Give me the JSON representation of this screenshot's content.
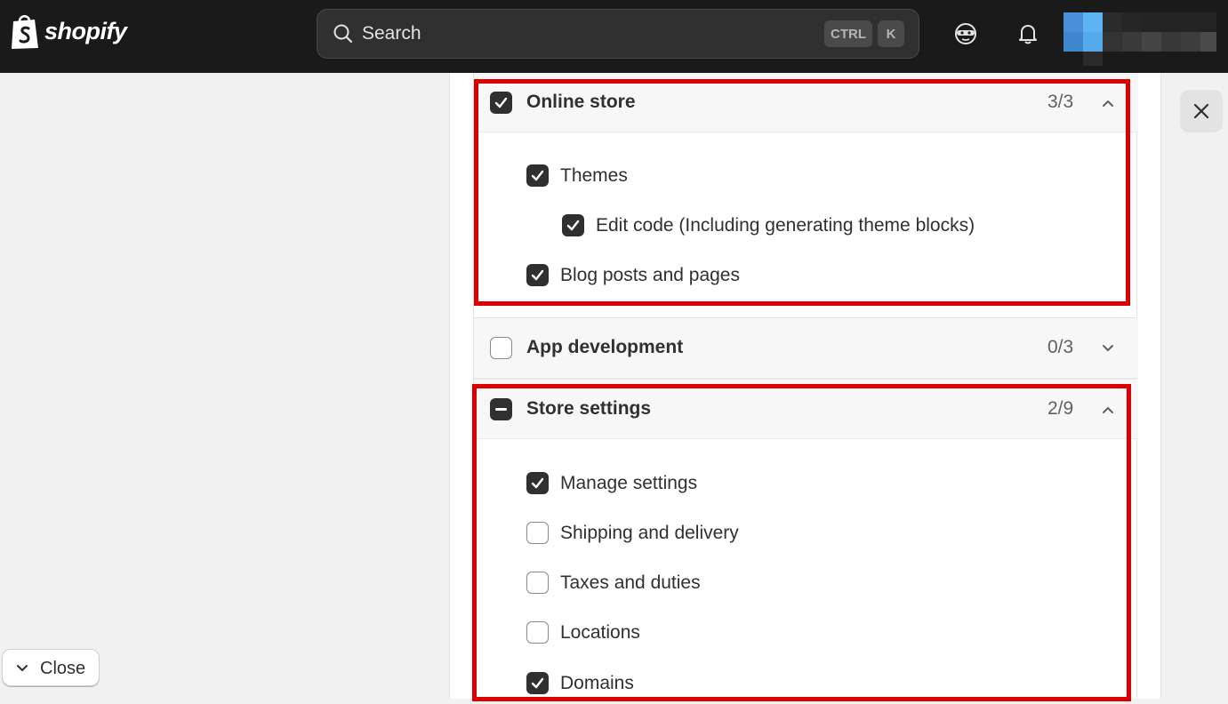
{
  "topbar": {
    "brand": "shopify",
    "search_placeholder": "Search",
    "shortcut_ctrl": "CTRL",
    "shortcut_k": "K"
  },
  "left_panel": {
    "close_label": "Close"
  },
  "sections": {
    "online_store": {
      "title": "Online store",
      "count": "3/3",
      "state": "checked",
      "expanded": true,
      "items": [
        {
          "label": "Themes",
          "checked": true
        },
        {
          "label": "Edit code (Including generating theme blocks)",
          "checked": true
        },
        {
          "label": "Blog posts and pages",
          "checked": true
        }
      ]
    },
    "app_development": {
      "title": "App development",
      "count": "0/3",
      "state": "unchecked",
      "expanded": false
    },
    "store_settings": {
      "title": "Store settings",
      "count": "2/9",
      "state": "indeterminate",
      "expanded": true,
      "items": [
        {
          "label": "Manage settings",
          "checked": true
        },
        {
          "label": "Shipping and delivery",
          "checked": false
        },
        {
          "label": "Taxes and duties",
          "checked": false
        },
        {
          "label": "Locations",
          "checked": false
        },
        {
          "label": "Domains",
          "checked": true
        }
      ]
    }
  },
  "colors": {
    "topbar_bg": "#1a1a1a",
    "highlight": "#dd0000",
    "checkbox_checked": "#303030"
  }
}
